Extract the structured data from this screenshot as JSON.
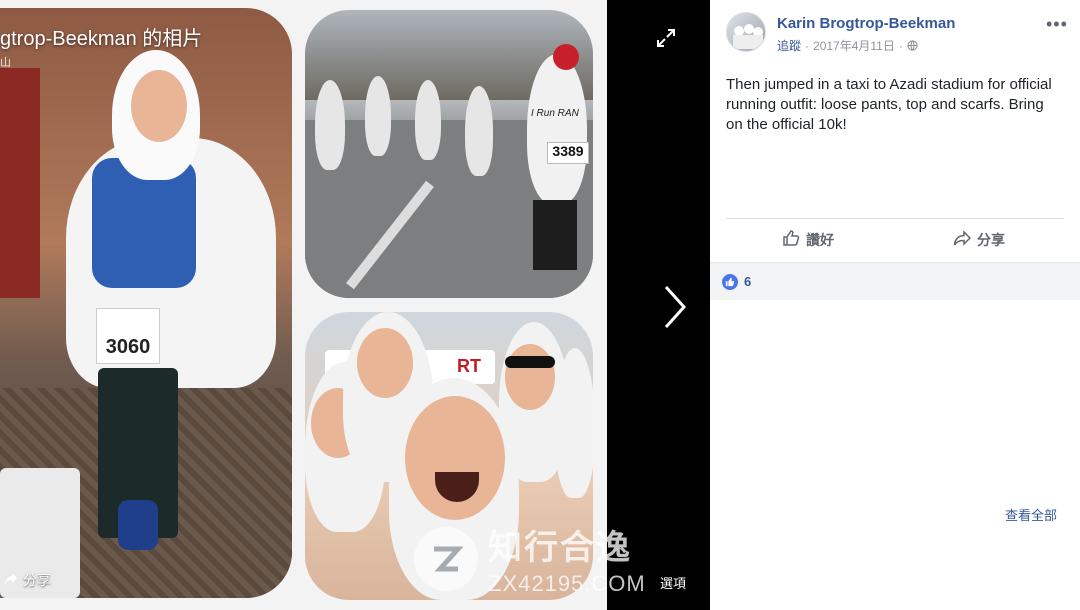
{
  "viewer": {
    "title": "gtrop-Beekman 的相片",
    "subtitle": "山",
    "share_label": "分享",
    "options_label": "選項",
    "photo1_bib": "3060",
    "photo2_bib": "3389",
    "photo2_shirt": "I Run RAN",
    "photo3_banner": "RT"
  },
  "watermark": {
    "brand": "知行合逸",
    "url": "ZX42195.COM"
  },
  "post": {
    "author": "Karin Brogtrop-Beekman",
    "follow_label": "追蹤",
    "date": "2017年4月11日",
    "dot": "·",
    "text": "Then jumped in a taxi to Azadi stadium for official running outfit: loose pants, top and scarfs. Bring on the official 10k!",
    "like_label": "讚好",
    "share_label": "分享",
    "reaction_count": "6",
    "view_all_label": "查看全部"
  },
  "colors": {
    "link": "#365899",
    "like_blue": "#4a76e8",
    "text": "#1d2129",
    "muted": "#90949c"
  },
  "icons": [
    "expand-icon",
    "next-arrow-icon",
    "share-icon",
    "more-icon",
    "globe-icon",
    "like-icon",
    "share-arrow-icon",
    "like-badge-icon"
  ]
}
